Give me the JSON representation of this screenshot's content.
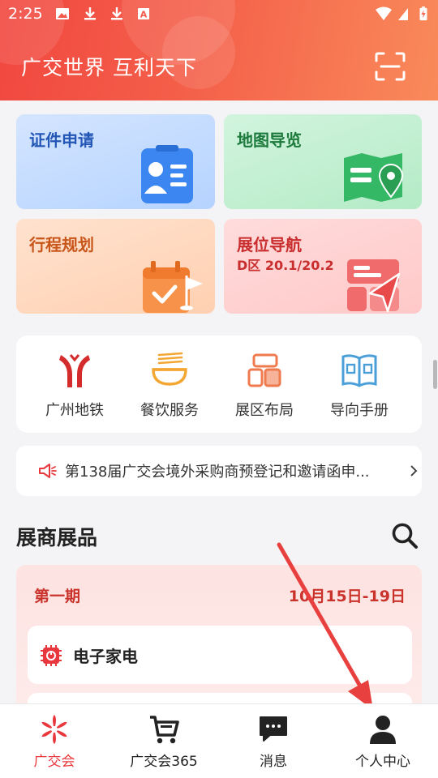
{
  "status_bar": {
    "time": "2:25"
  },
  "header": {
    "title": "广交世界 互利天下"
  },
  "cards": [
    {
      "title": "证件申请"
    },
    {
      "title": "地图导览"
    },
    {
      "title": "行程规划"
    },
    {
      "title": "展位导航",
      "subtitle": "D区 20.1/20.2"
    }
  ],
  "quick_links": [
    {
      "label": "广州地铁"
    },
    {
      "label": "餐饮服务"
    },
    {
      "label": "展区布局"
    },
    {
      "label": "导向手册"
    }
  ],
  "notice": {
    "text": "第138届广交会境外采购商预登记和邀请函申..."
  },
  "section": {
    "title": "展商展品"
  },
  "period": {
    "name": "第一期",
    "dates": "10月15日-19日",
    "categories": [
      {
        "label": "电子家电"
      },
      {
        "label": ""
      }
    ]
  },
  "tabs": [
    {
      "label": "广交会"
    },
    {
      "label": "广交会365"
    },
    {
      "label": "消息"
    },
    {
      "label": "个人中心"
    }
  ],
  "colors": {
    "accent": "#e8383d",
    "header_start": "#f1473f",
    "header_end": "#f98a5a",
    "annotation_arrow": "#e8403e"
  }
}
